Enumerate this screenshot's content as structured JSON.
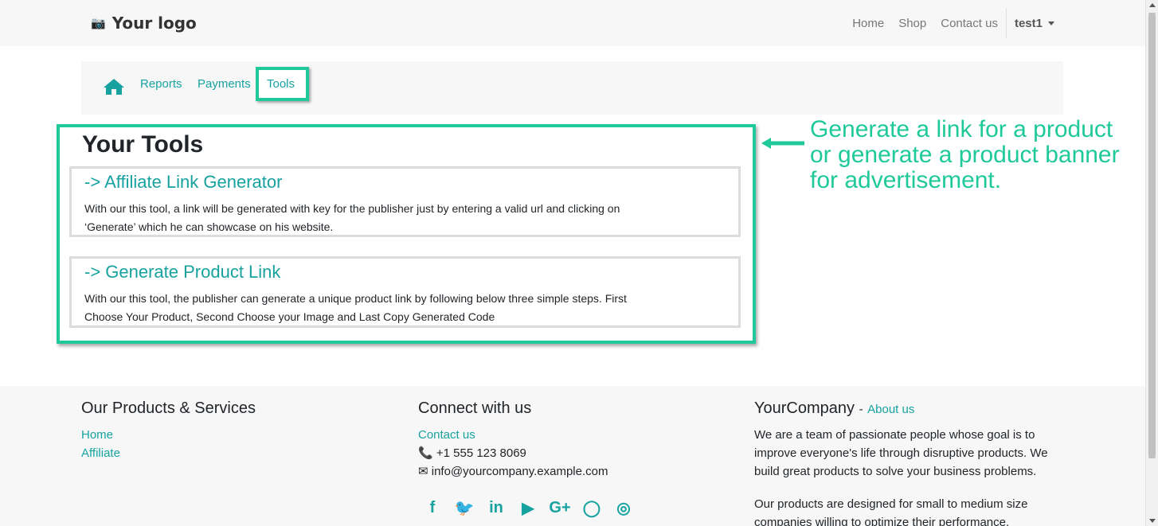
{
  "header": {
    "logo_text": "Your logo",
    "nav": [
      "Home",
      "Shop",
      "Contact us"
    ],
    "user": "test1"
  },
  "subnav": {
    "items": [
      "Reports",
      "Payments",
      "Tools"
    ]
  },
  "main": {
    "title": "Your Tools",
    "cards": [
      {
        "heading": "-> Affiliate Link Generator",
        "line1": "With our this tool, a link will be generated with key for the publisher just by entering a valid url and clicking on",
        "line2": "‘Generate’ which he can showcase on his website."
      },
      {
        "heading": "-> Generate Product Link",
        "line1": "With our this tool, the publisher can generate a unique product link by following below three simple steps. First",
        "line2": "Choose Your Product, Second Choose your Image and Last Copy Generated Code"
      }
    ]
  },
  "annotation": {
    "line1": "Generate a link for a product",
    "line2": "or generate a product banner",
    "line3": "for advertisement.",
    "color": "#1fc99a"
  },
  "footer": {
    "col1": {
      "title": "Our Products & Services",
      "links": [
        "Home",
        "Affiliate"
      ]
    },
    "col2": {
      "title": "Connect with us",
      "contact_link": "Contact us",
      "phone": "+1 555 123 8069",
      "email": "info@yourcompany.example.com",
      "socials": [
        "facebook-icon",
        "twitter-icon",
        "linkedin-icon",
        "youtube-icon",
        "google-plus-icon",
        "github-icon",
        "instagram-icon"
      ]
    },
    "col3": {
      "company": "YourCompany",
      "about_sep": "-",
      "about_link": "About us",
      "p1_l1": "We are a team of passionate people whose goal is to",
      "p1_l2": "improve everyone's life through disruptive products. We",
      "p1_l3": "build great products to solve your business problems.",
      "p2_l1": "Our products are designed for small to medium size",
      "p2_l2": "companies willing to optimize their performance."
    }
  },
  "colors": {
    "accent": "#17a2a0",
    "highlight": "#1fc99a"
  }
}
